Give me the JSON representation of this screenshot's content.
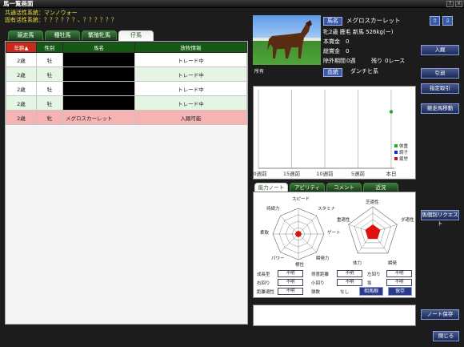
{
  "window": {
    "title": "馬一覧画面",
    "help": "?",
    "close": "×"
  },
  "lines": {
    "common": "共通活性系統：マンノウォー",
    "unique": "固有活性系統：？？？？？？、？？？？？？"
  },
  "tabs": [
    {
      "label": "競走馬"
    },
    {
      "label": "種牡馬"
    },
    {
      "label": "繁殖牝馬"
    },
    {
      "label": "仔馬"
    }
  ],
  "table": {
    "headers": [
      "年齢▲",
      "性別",
      "馬名",
      "放牧情報"
    ],
    "rows": [
      {
        "age": "2歳",
        "sex": "牡",
        "name": "",
        "status": "トレード中"
      },
      {
        "age": "2歳",
        "sex": "牡",
        "name": "",
        "status": "トレード中"
      },
      {
        "age": "2歳",
        "sex": "牡",
        "name": "",
        "status": "トレード中"
      },
      {
        "age": "2歳",
        "sex": "牡",
        "name": "",
        "status": "トレード中"
      },
      {
        "age": "2歳",
        "sex": "牝",
        "name": "メグロスカーレット",
        "status": "入厩可能"
      }
    ]
  },
  "horse": {
    "name_label": "馬名",
    "name": "メグロスカーレット",
    "profile": "牝2歳 鹿毛 新馬 526kg(ー)",
    "prize_label": "本賞金",
    "prize": "0",
    "total_label": "総賞金",
    "total": "0",
    "period_label": "除外期間",
    "period": "0週",
    "remaining_label": "残り",
    "remaining": "0レース",
    "owner_label": "所有",
    "bloodline_label": "血統",
    "sire": "ダンチヒ系"
  },
  "side_buttons": {
    "up": "⇧",
    "down": "⇩",
    "admit": "入厩",
    "retire": "引退",
    "designate": "指定取引",
    "transfer": "競走馬移動",
    "request": "馬個別リクエスト",
    "note_save": "ノート保存",
    "close": "閉じる"
  },
  "chart_data": {
    "type": "scatter",
    "x_categories": [
      "20週前",
      "15週前",
      "10週前",
      "5週前",
      "本日"
    ],
    "series": [
      {
        "name": "体重",
        "color": "#22aa22",
        "points": [
          {
            "x": "本日",
            "y": 0.72
          }
        ]
      },
      {
        "name": "調子",
        "color": "#1a2ad0",
        "points": []
      },
      {
        "name": "疲労",
        "color": "#c01a1a",
        "points": []
      }
    ]
  },
  "subtabs": [
    {
      "label": "能力ノート"
    },
    {
      "label": "アビリティ"
    },
    {
      "label": "コメント"
    },
    {
      "label": "近況"
    }
  ],
  "radar1": {
    "labels": [
      "スピード",
      "スタミナ",
      "ゲート",
      "瞬発力",
      "根性",
      "パワー",
      "柔軟",
      "持続力"
    ]
  },
  "radar2": {
    "labels": [
      "芝適性",
      "ダ適性",
      "瞬発",
      "体力",
      "重適性"
    ]
  },
  "attributes": {
    "growth_label": "成長型",
    "growth": "不明",
    "dist_label": "得意距離",
    "dist": "不明",
    "leftturn_label": "左回り",
    "leftturn": "不明",
    "rightturn_label": "右回り",
    "rightturn": "不明",
    "smallturn_label": "小回り",
    "smallturn": "不明",
    "slope_label": "坂",
    "slope": "不明",
    "distaptitude_label": "距離適性",
    "distaptitude": "不明",
    "heavy_label": "弾数",
    "heavy": "なし",
    "pedigree_btn": "相馬眼",
    "save_btn": "保存"
  }
}
